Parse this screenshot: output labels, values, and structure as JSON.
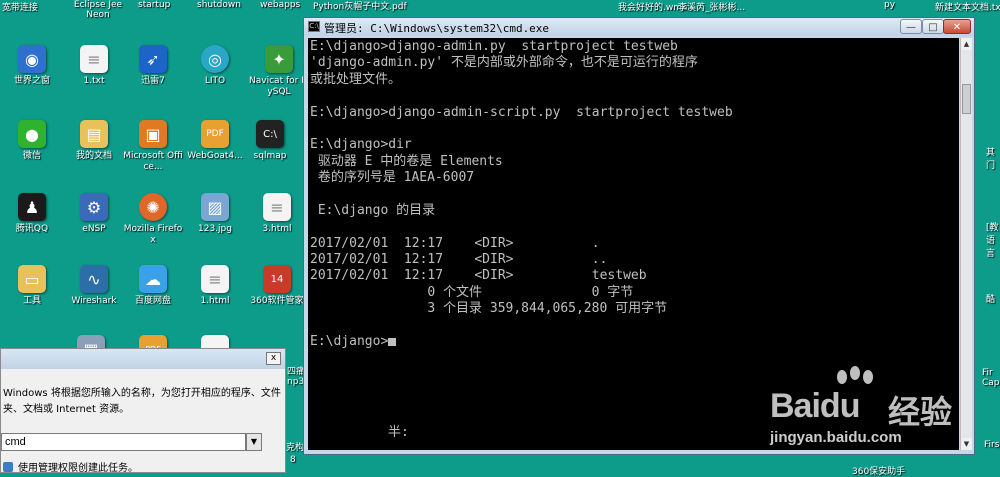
{
  "desktop": {
    "top_labels": [
      "宽带连接",
      "Eclipse Jee Neon",
      "startup",
      "shutdown",
      "webapps",
      "Python灰帽子中文.pdf",
      "我会好好的.wma",
      "李溪芮_张彬彬...",
      "py",
      "新建文本文档.txt"
    ],
    "icons": [
      {
        "label": "世界之窗",
        "icon": "globe-icon",
        "color": "#2f6fd0"
      },
      {
        "label": "1.txt",
        "icon": "text-file-icon",
        "color": "#f4f4f4"
      },
      {
        "label": "迅雷7",
        "icon": "thunder-bird-icon",
        "color": "#1d64c8"
      },
      {
        "label": "LITO",
        "icon": "lito-icon",
        "color": "#2aa6c7"
      },
      {
        "label": "Navicat for MySQL",
        "icon": "navicat-icon",
        "color": "#3a9b3a"
      },
      {
        "label": "微信",
        "icon": "wechat-icon",
        "color": "#2fb32f"
      },
      {
        "label": "我的文档",
        "icon": "folder-shortcut-icon",
        "color": "#e8c15a"
      },
      {
        "label": "Microsoft Office...",
        "icon": "office-icon",
        "color": "#e07a22"
      },
      {
        "label": "WebGoat4...",
        "icon": "pdf-icon",
        "color": "#e8a030"
      },
      {
        "label": "sqlmap",
        "icon": "console-icon",
        "color": "#222222"
      },
      {
        "label": "腾讯QQ",
        "icon": "qq-penguin-icon",
        "color": "#1a1a1a"
      },
      {
        "label": "eNSP",
        "icon": "ensp-icon",
        "color": "#3a6ab8"
      },
      {
        "label": "Mozilla Firefox",
        "icon": "firefox-icon",
        "color": "#e0662a"
      },
      {
        "label": "123.jpg",
        "icon": "image-file-icon",
        "color": "#7aa6d4"
      },
      {
        "label": "3.html",
        "icon": "html-file-icon",
        "color": "#f4f4f4"
      },
      {
        "label": "工具",
        "icon": "folder-icon",
        "color": "#e8c15a"
      },
      {
        "label": "Wireshark",
        "icon": "wireshark-icon",
        "color": "#2b6ea8"
      },
      {
        "label": "百度网盘",
        "icon": "cloud-icon",
        "color": "#3aa0e8"
      },
      {
        "label": "1.html",
        "icon": "html-file-icon",
        "color": "#f4f4f4"
      },
      {
        "label": "360软件管家",
        "icon": "360-manager-icon",
        "color": "#c83a2a"
      }
    ],
    "right_labels": [
      "其\n门",
      "[教\n语言",
      "酷",
      "Fir\nCap",
      "Firs"
    ],
    "bottom_misc": [
      "四痛",
      "np3",
      "克构",
      "8",
      "360保安助手"
    ]
  },
  "cmd": {
    "title": "管理员: C:\\Windows\\system32\\cmd.exe",
    "lines": [
      "E:\\django>django-admin.py  startproject testweb",
      "'django-admin.py' 不是内部或外部命令，也不是可运行的程序",
      "或批处理文件。",
      "",
      "E:\\django>django-admin-script.py  startproject testweb",
      "",
      "E:\\django>dir",
      " 驱动器 E 中的卷是 Elements",
      " 卷的序列号是 1AEA-6007",
      "",
      " E:\\django 的目录",
      "",
      "2017/02/01  12:17    <DIR>          .",
      "2017/02/01  12:17    <DIR>          ..",
      "2017/02/01  12:17    <DIR>          testweb",
      "               0 个文件              0 字节",
      "               3 个目录 359,844,065,280 可用字节",
      "",
      "E:\\django>"
    ],
    "ime_status": "半:",
    "buttons": {
      "min": "—",
      "max": "□",
      "close": "✕"
    }
  },
  "run_dialog": {
    "description": "Windows 将根据您所输入的名称，为您打开相应的程序、文件夹、文档或 Internet 资源。",
    "input_value": "cmd",
    "admin_note": "使用管理权限创建此任务。",
    "close": "x"
  },
  "watermark": {
    "brand": "Bai",
    "brand2": "du",
    "jingyan": "经验",
    "url": "jingyan.baidu.com"
  }
}
